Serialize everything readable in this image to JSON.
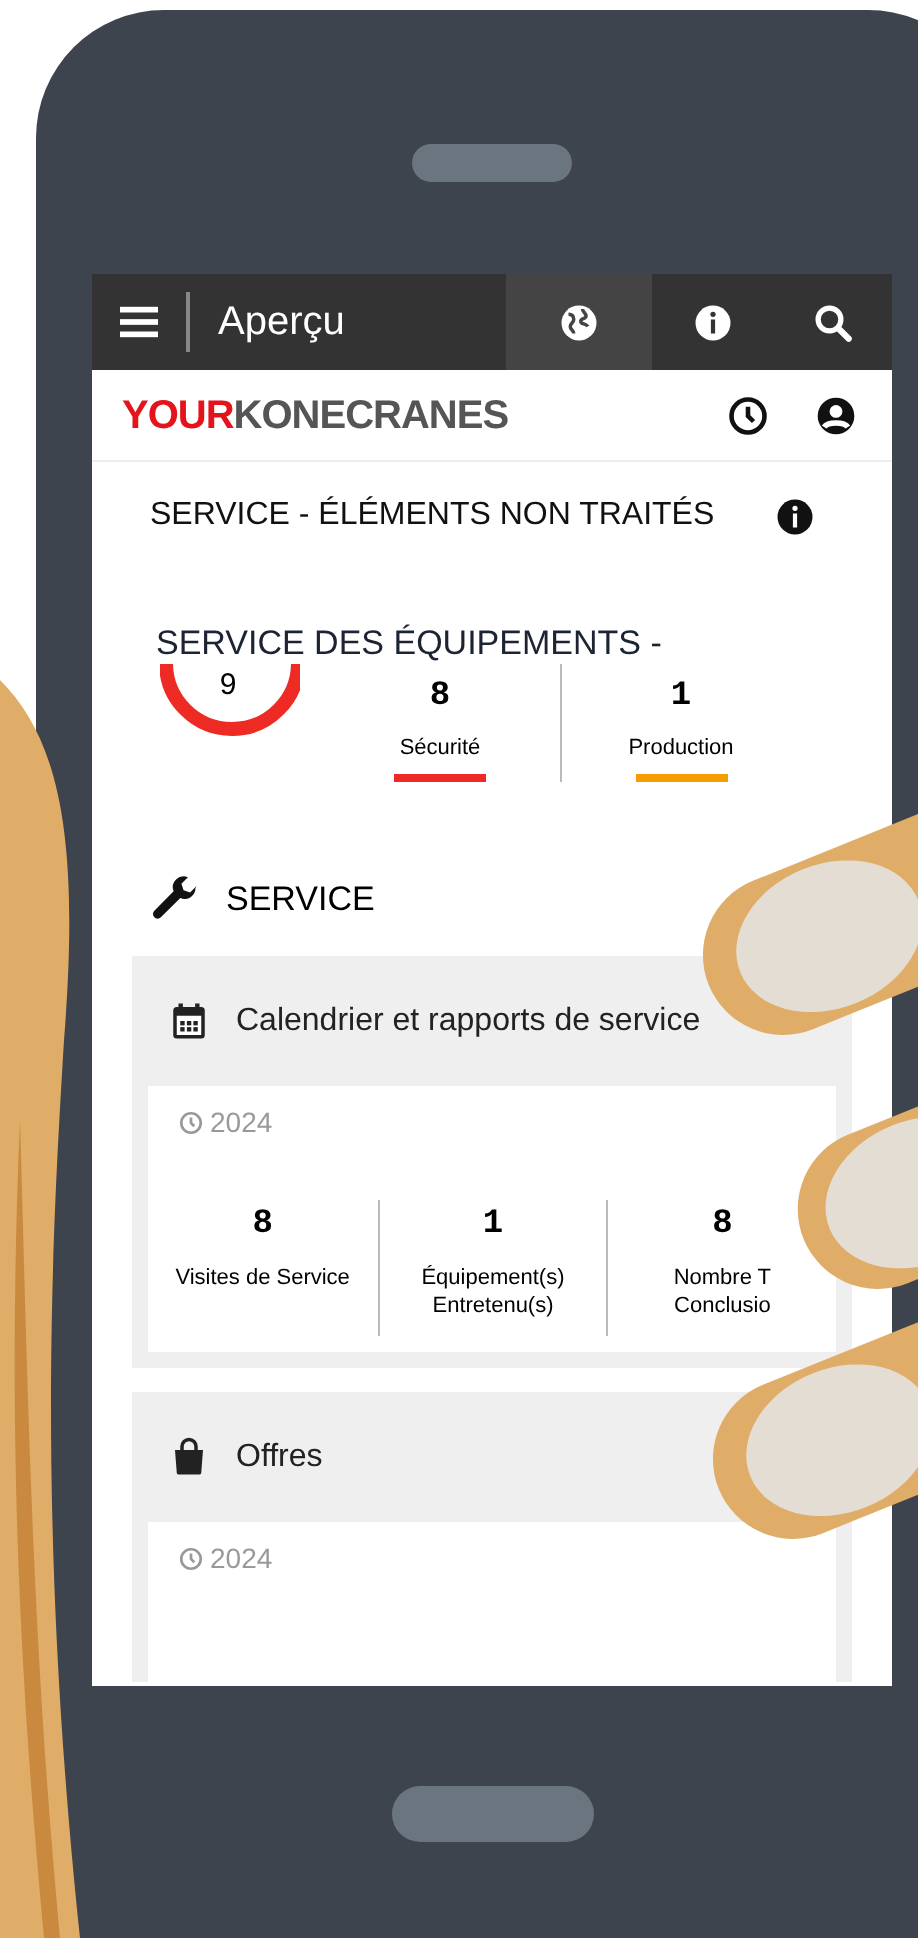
{
  "top_bar": {
    "title": "Aperçu",
    "tabs": [
      {
        "selected": true
      },
      {
        "selected": false
      },
      {
        "selected": false
      }
    ]
  },
  "brand": {
    "part_1": "YOUR",
    "part_2": "KONECRANES"
  },
  "overview": {
    "title": "SERVICE - ÉLÉMENTS NON TRAITÉS",
    "subtitle": "SERVICE DES ÉQUIPEMENTS -",
    "total": "9",
    "stats": [
      {
        "value": "8",
        "label": "Sécurité",
        "color": "#ee2a24"
      },
      {
        "value": "1",
        "label": "Production",
        "color": "#f59c00"
      }
    ]
  },
  "section": {
    "title": "SERVICE"
  },
  "cards": [
    {
      "kind": "calendar",
      "title": "Calendrier et rapports de service",
      "year": "2024",
      "stats": [
        {
          "value": "8",
          "label": "Visites de Service"
        },
        {
          "value": "1",
          "label": "Équipement(s) Entretenu(s)"
        },
        {
          "value": "8",
          "label": "Nombre T Conclusio"
        }
      ]
    },
    {
      "kind": "bag",
      "title": "Offres",
      "year": "2024"
    }
  ]
}
